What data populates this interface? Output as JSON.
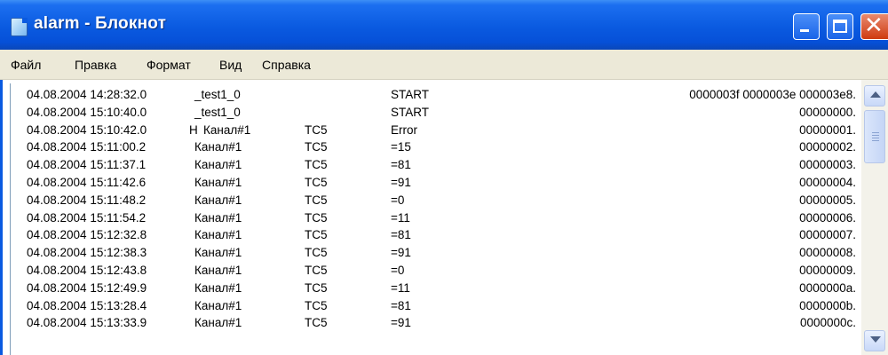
{
  "window": {
    "title": "alarm - Блокнот"
  },
  "menu": [
    "Файл",
    "Правка",
    "Формат",
    "Вид",
    "Справка"
  ],
  "lines": [
    {
      "ts": "04.08.2004 14:28:32.0",
      "flag": "",
      "source": "_test1_0",
      "tag": "",
      "value": "START",
      "code": "0000003f 0000003e 000003e8."
    },
    {
      "ts": "04.08.2004 15:10:40.0",
      "flag": "",
      "source": "_test1_0",
      "tag": "",
      "value": "START",
      "code": "00000000."
    },
    {
      "ts": "04.08.2004 15:10:42.0",
      "flag": "Н",
      "source": "Канал#1",
      "tag": "ТС5",
      "value": "Error",
      "code": "00000001."
    },
    {
      "ts": "04.08.2004 15:11:00.2",
      "flag": "",
      "source": "Канал#1",
      "tag": "ТС5",
      "value": "=15",
      "code": "00000002."
    },
    {
      "ts": "04.08.2004 15:11:37.1",
      "flag": "",
      "source": "Канал#1",
      "tag": "ТС5",
      "value": "=81",
      "code": "00000003."
    },
    {
      "ts": "04.08.2004 15:11:42.6",
      "flag": "",
      "source": "Канал#1",
      "tag": "ТС5",
      "value": "=91",
      "code": "00000004."
    },
    {
      "ts": "04.08.2004 15:11:48.2",
      "flag": "",
      "source": "Канал#1",
      "tag": "ТС5",
      "value": "=0",
      "code": "00000005."
    },
    {
      "ts": "04.08.2004 15:11:54.2",
      "flag": "",
      "source": "Канал#1",
      "tag": "ТС5",
      "value": "=11",
      "code": "00000006."
    },
    {
      "ts": "04.08.2004 15:12:32.8",
      "flag": "",
      "source": "Канал#1",
      "tag": "ТС5",
      "value": "=81",
      "code": "00000007."
    },
    {
      "ts": "04.08.2004 15:12:38.3",
      "flag": "",
      "source": "Канал#1",
      "tag": "ТС5",
      "value": "=91",
      "code": "00000008."
    },
    {
      "ts": "04.08.2004 15:12:43.8",
      "flag": "",
      "source": "Канал#1",
      "tag": "ТС5",
      "value": "=0",
      "code": "00000009."
    },
    {
      "ts": "04.08.2004 15:12:49.9",
      "flag": "",
      "source": "Канал#1",
      "tag": "ТС5",
      "value": "=11",
      "code": "0000000a."
    },
    {
      "ts": "04.08.2004 15:13:28.4",
      "flag": "",
      "source": "Канал#1",
      "tag": "ТС5",
      "value": "=81",
      "code": "0000000b."
    },
    {
      "ts": "04.08.2004 15:13:33.9",
      "flag": "",
      "source": "Канал#1",
      "tag": "ТС5",
      "value": "=91",
      "code": "0000000c."
    }
  ],
  "icons": {
    "app": "notepad-icon",
    "minimize": "minimize-icon",
    "maximize": "maximize-icon",
    "close": "close-icon",
    "scroll_up": "scroll-up-arrow-icon",
    "scroll_down": "scroll-down-arrow-icon"
  },
  "colors": {
    "titlebar": "#0a5ae0",
    "close_button": "#cf3a10",
    "menubar": "#ece9d8"
  }
}
